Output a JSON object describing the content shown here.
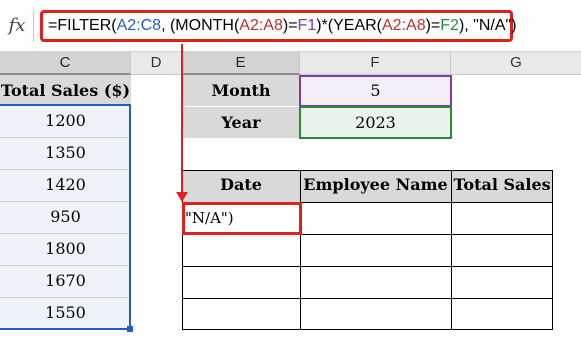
{
  "formula_bar": {
    "fx_label": "fx",
    "tokens": [
      {
        "text": "=FILTER(",
        "color": "black"
      },
      {
        "text": "A2:C8",
        "color": "blue"
      },
      {
        "text": ", (MONTH(",
        "color": "black"
      },
      {
        "text": "A2:A8",
        "color": "red"
      },
      {
        "text": ")=",
        "color": "black"
      },
      {
        "text": "F1",
        "color": "purple"
      },
      {
        "text": ")*(YEAR(",
        "color": "black"
      },
      {
        "text": "A2:A8",
        "color": "red"
      },
      {
        "text": ")=",
        "color": "black"
      },
      {
        "text": "F2",
        "color": "green"
      },
      {
        "text": "), \"N/A\")",
        "color": "black"
      }
    ]
  },
  "columns": {
    "C": "C",
    "D": "D",
    "E": "E",
    "F": "F",
    "G": "G"
  },
  "column_c": {
    "header": "Total Sales ($)",
    "values": [
      "1200",
      "1350",
      "1420",
      "950",
      "1800",
      "1670",
      "1550"
    ]
  },
  "criteria": {
    "month_label": "Month",
    "month_value": "5",
    "year_label": "Year",
    "year_value": "2023"
  },
  "result_table": {
    "headers": [
      "Date",
      "Employee Name",
      "Total Sales"
    ],
    "active_cell_text": "\"N/A\")"
  },
  "colors": {
    "highlight_red": "#e0211b",
    "ref_blue": "#1f5fbf",
    "ref_purple": "#7a3ea6",
    "ref_green": "#2a8a3a",
    "criteria_month_fill": "#f3eef9",
    "criteria_year_fill": "#eaf4ec",
    "label_fill": "#d9d9d9"
  }
}
